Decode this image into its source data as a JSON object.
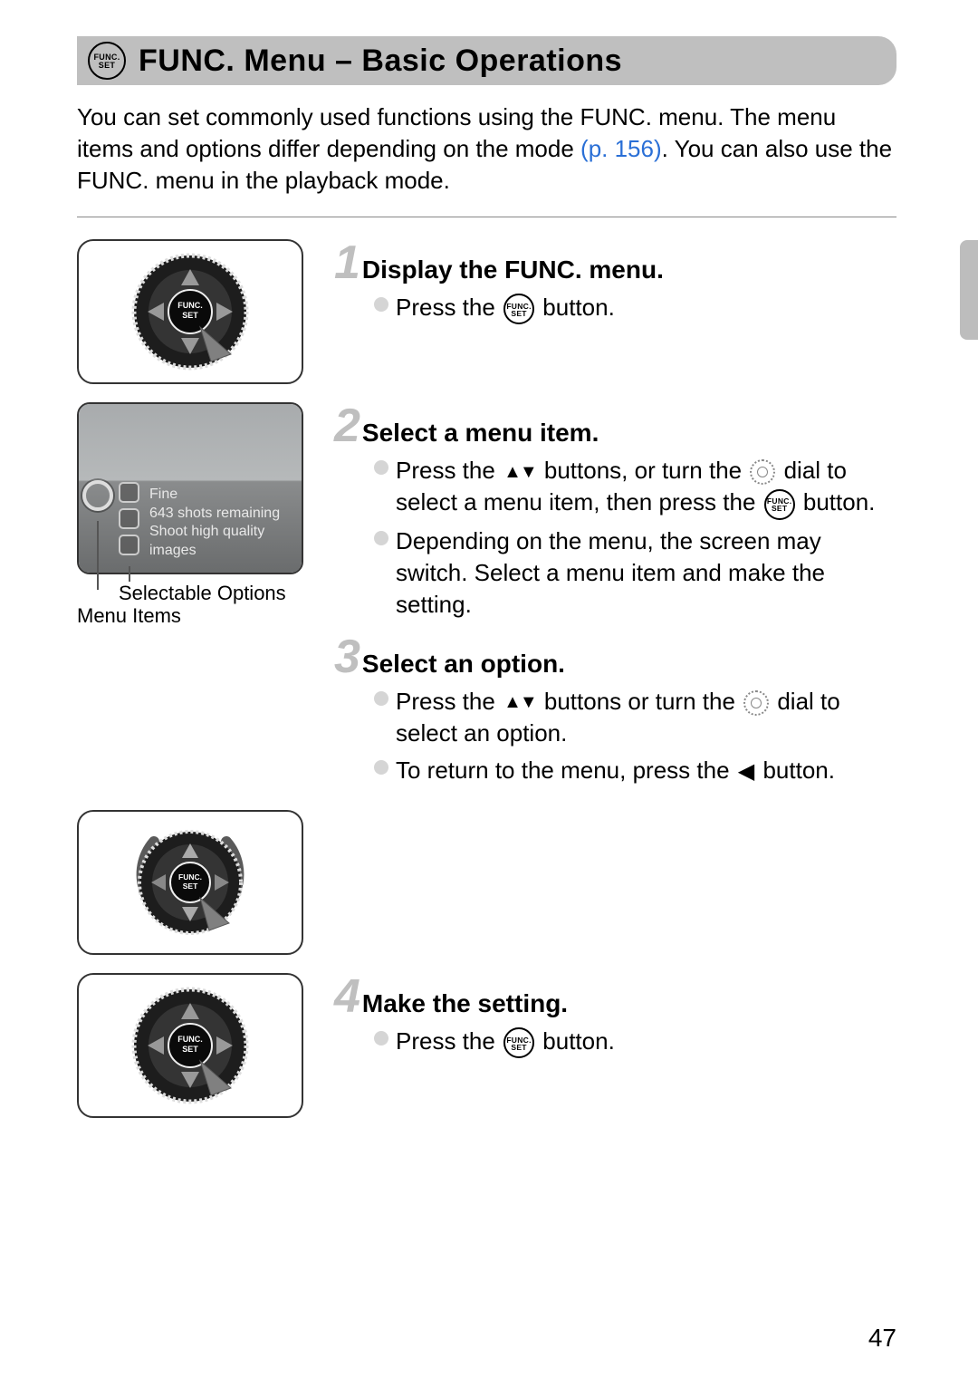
{
  "header": {
    "badge_top": "FUNC.",
    "badge_bottom": "SET",
    "title": "FUNC. Menu – Basic Operations"
  },
  "intro": {
    "part1": "You can set commonly used functions using the FUNC. menu. The menu items and options differ depending on the mode ",
    "link": "(p. 156)",
    "part2": ". You can also use the FUNC. menu in the playback mode."
  },
  "screen": {
    "line1": "Fine",
    "line2": "643 shots remaining",
    "line3": "Shoot high quality",
    "line4": "images"
  },
  "callouts": {
    "selectable": "Selectable Options",
    "menu_items": "Menu Items"
  },
  "steps": [
    {
      "num": "1",
      "title": "Display the FUNC. menu.",
      "bullets": [
        {
          "pre": "Press the ",
          "icon": "func",
          "post": " button."
        }
      ]
    },
    {
      "num": "2",
      "title": "Select a menu item.",
      "bullets": [
        {
          "pre": "Press the ",
          "icon": "updown",
          "mid": " buttons, or turn the ",
          "icon2": "dial",
          "post2": " dial to select a menu item, then press the ",
          "icon3": "func",
          "post3": " button."
        },
        {
          "pre": "Depending on the menu, the screen may switch. Select a menu item and make the setting."
        }
      ]
    },
    {
      "num": "3",
      "title": "Select an option.",
      "bullets": [
        {
          "pre": "Press the ",
          "icon": "updown",
          "mid": " buttons or turn the ",
          "icon2": "dial",
          "post2": " dial to select an option."
        },
        {
          "pre": "To return to the menu, press the ",
          "icon": "left",
          "post": " button."
        }
      ]
    },
    {
      "num": "4",
      "title": "Make the setting.",
      "bullets": [
        {
          "pre": "Press the ",
          "icon": "func",
          "post": " button."
        }
      ]
    }
  ],
  "page_number": "47"
}
